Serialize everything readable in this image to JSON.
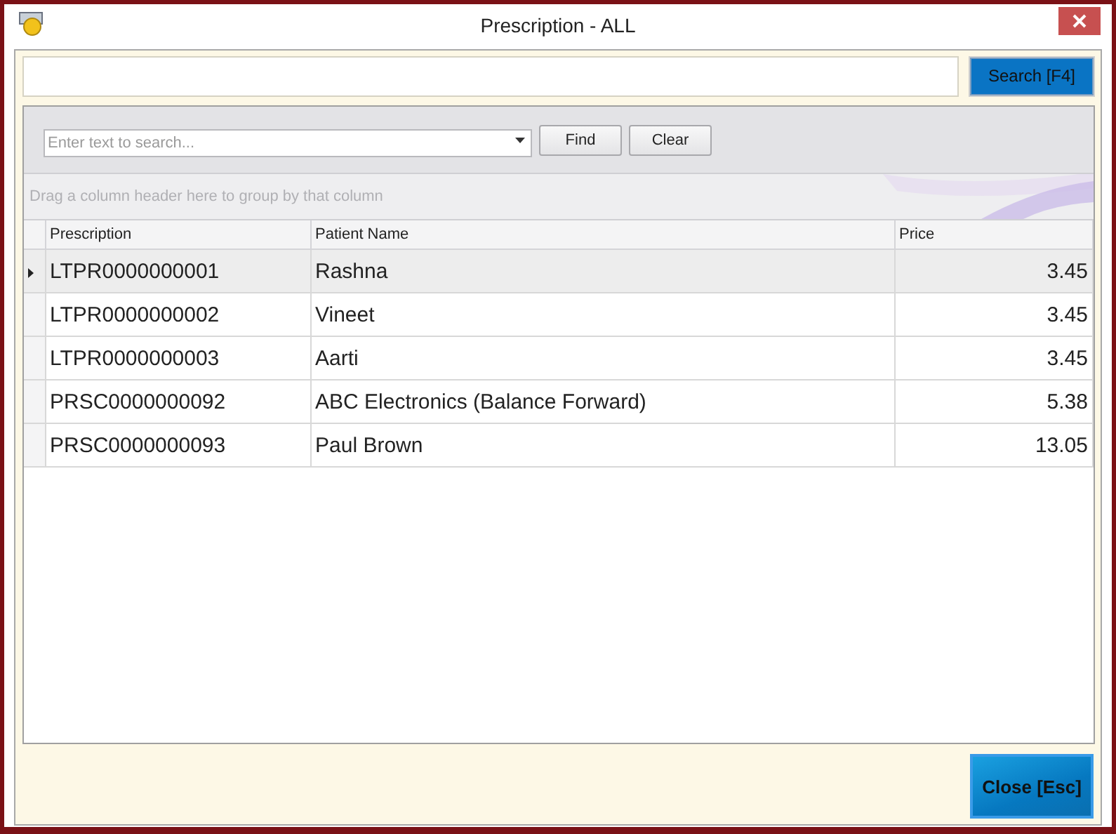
{
  "window": {
    "title": "Prescription - ALL"
  },
  "search": {
    "button": "Search [F4]"
  },
  "find_panel": {
    "placeholder": "Enter text to search...",
    "find": "Find",
    "clear": "Clear"
  },
  "group_panel": {
    "hint": "Drag a column header here to group by that column"
  },
  "table": {
    "columns": [
      "Prescription",
      "Patient Name",
      "Price"
    ],
    "rows": [
      {
        "cells": [
          "LTPR0000000001",
          "Rashna",
          "3.45"
        ],
        "selected": true
      },
      {
        "cells": [
          "LTPR0000000002",
          "Vineet",
          "3.45"
        ],
        "selected": false
      },
      {
        "cells": [
          "LTPR0000000003",
          "Aarti",
          "3.45"
        ],
        "selected": false
      },
      {
        "cells": [
          "PRSC0000000092",
          "ABC Electronics (Balance Forward)",
          "5.38"
        ],
        "selected": false
      },
      {
        "cells": [
          "PRSC0000000093",
          "Paul Brown",
          "13.05"
        ],
        "selected": false
      }
    ]
  },
  "close_button": "Close [Esc]"
}
